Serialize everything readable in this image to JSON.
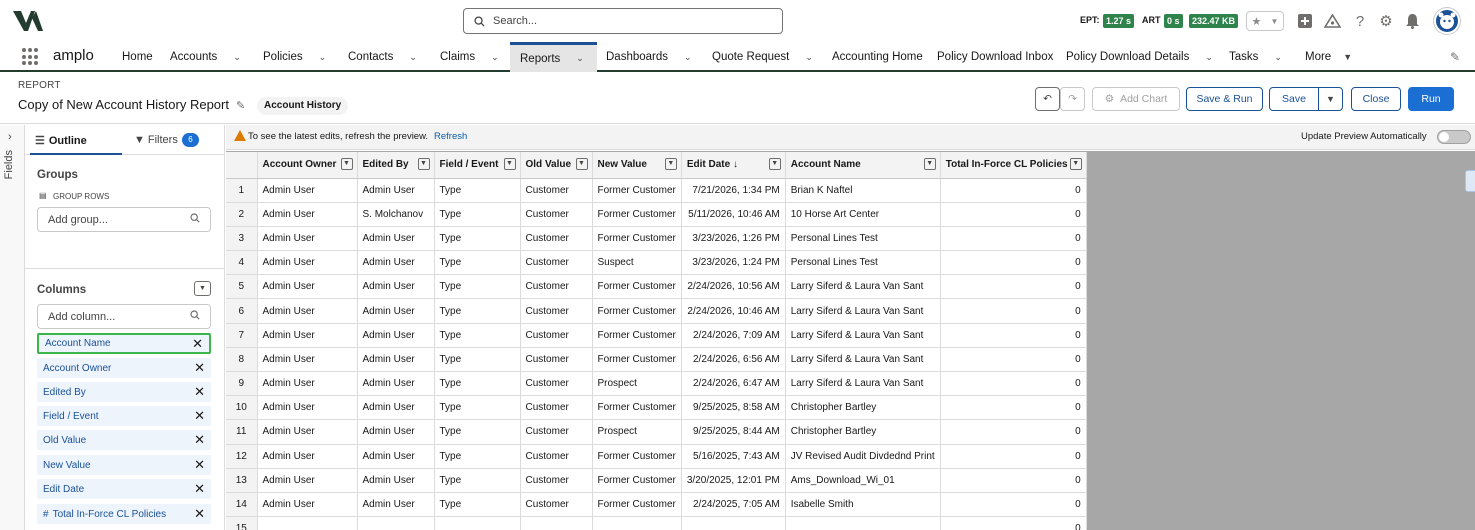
{
  "search": {
    "placeholder": "Search..."
  },
  "metrics": {
    "ept_label": "EPT:",
    "ept_value": "1.27 s",
    "art_label": "ART",
    "art_value": "0 s",
    "size_value": "232.47 KB"
  },
  "colors": {
    "accent": "#1b5297",
    "primary_button": "#1b6fd2",
    "metric_pill": "#2e844a",
    "highlight": "#3cb54a"
  },
  "app": {
    "name": "amplo"
  },
  "nav": [
    {
      "label": "Home"
    },
    {
      "label": "Accounts"
    },
    {
      "label": "Policies"
    },
    {
      "label": "Contacts"
    },
    {
      "label": "Claims"
    },
    {
      "label": "Reports"
    },
    {
      "label": "Dashboards"
    },
    {
      "label": "Quote Request"
    },
    {
      "label": "Accounting Home"
    },
    {
      "label": "Policy Download Inbox"
    },
    {
      "label": "Policy Download Details"
    },
    {
      "label": "Tasks"
    },
    {
      "label": "More"
    }
  ],
  "report": {
    "label": "REPORT",
    "title": "Copy of New Account History Report",
    "type": "Account History"
  },
  "buttons": {
    "add_chart": "Add Chart",
    "save_run": "Save & Run",
    "save": "Save",
    "close": "Close",
    "run": "Run"
  },
  "left": {
    "fields_label": "Fields",
    "tab_outline": "Outline",
    "tab_filters": "Filters",
    "filters_count": "6",
    "groups_title": "Groups",
    "group_rows": "GROUP ROWS",
    "add_group_placeholder": "Add group...",
    "columns_title": "Columns",
    "add_column_placeholder": "Add column...",
    "columns": [
      "Account Name",
      "Account Owner",
      "Edited By",
      "Field / Event",
      "Old Value",
      "New Value",
      "Edit Date",
      "Total In-Force CL Policies"
    ]
  },
  "banner": {
    "text": "To see the latest edits, refresh the preview.",
    "refresh": "Refresh",
    "auto": "Update Preview Automatically"
  },
  "table": {
    "headers": [
      "Account Owner",
      "Edited By",
      "Field / Event",
      "Old Value",
      "New Value",
      "Edit Date",
      "Account Name",
      "Total In-Force CL Policies"
    ],
    "rows": [
      [
        "1",
        "Admin User",
        "Admin User",
        "Type",
        "Customer",
        "Former Customer",
        "7/21/2026, 1:34 PM",
        "Brian K Naftel",
        "0"
      ],
      [
        "2",
        "Admin User",
        "S. Molchanov",
        "Type",
        "Customer",
        "Former Customer",
        "5/11/2026, 10:46 AM",
        "10 Horse Art Center",
        "0"
      ],
      [
        "3",
        "Admin User",
        "Admin User",
        "Type",
        "Customer",
        "Former Customer",
        "3/23/2026, 1:26 PM",
        "Personal Lines Test",
        "0"
      ],
      [
        "4",
        "Admin User",
        "Admin User",
        "Type",
        "Customer",
        "Suspect",
        "3/23/2026, 1:24 PM",
        "Personal Lines Test",
        "0"
      ],
      [
        "5",
        "Admin User",
        "Admin User",
        "Type",
        "Customer",
        "Former Customer",
        "2/24/2026, 10:56 AM",
        "Larry Siferd & Laura Van Sant",
        "0"
      ],
      [
        "6",
        "Admin User",
        "Admin User",
        "Type",
        "Customer",
        "Former Customer",
        "2/24/2026, 10:46 AM",
        "Larry Siferd & Laura Van Sant",
        "0"
      ],
      [
        "7",
        "Admin User",
        "Admin User",
        "Type",
        "Customer",
        "Former Customer",
        "2/24/2026, 7:09 AM",
        "Larry Siferd & Laura Van Sant",
        "0"
      ],
      [
        "8",
        "Admin User",
        "Admin User",
        "Type",
        "Customer",
        "Former Customer",
        "2/24/2026, 6:56 AM",
        "Larry Siferd & Laura Van Sant",
        "0"
      ],
      [
        "9",
        "Admin User",
        "Admin User",
        "Type",
        "Customer",
        "Prospect",
        "2/24/2026, 6:47 AM",
        "Larry Siferd & Laura Van Sant",
        "0"
      ],
      [
        "10",
        "Admin User",
        "Admin User",
        "Type",
        "Customer",
        "Former Customer",
        "9/25/2025, 8:58 AM",
        "Christopher Bartley",
        "0"
      ],
      [
        "11",
        "Admin User",
        "Admin User",
        "Type",
        "Customer",
        "Prospect",
        "9/25/2025, 8:44 AM",
        "Christopher Bartley",
        "0"
      ],
      [
        "12",
        "Admin User",
        "Admin User",
        "Type",
        "Customer",
        "Former Customer",
        "5/16/2025, 7:43 AM",
        "JV Revised Audit Divdednd Print",
        "0"
      ],
      [
        "13",
        "Admin User",
        "Admin User",
        "Type",
        "Customer",
        "Former Customer",
        "3/20/2025, 12:01 PM",
        "Ams_Download_Wi_01",
        "0"
      ],
      [
        "14",
        "Admin User",
        "Admin User",
        "Type",
        "Customer",
        "Former Customer",
        "2/24/2025, 7:05 AM",
        "Isabelle Smith",
        "0"
      ],
      [
        "15",
        "",
        "",
        "",
        "",
        "",
        "",
        "",
        "0"
      ]
    ]
  }
}
